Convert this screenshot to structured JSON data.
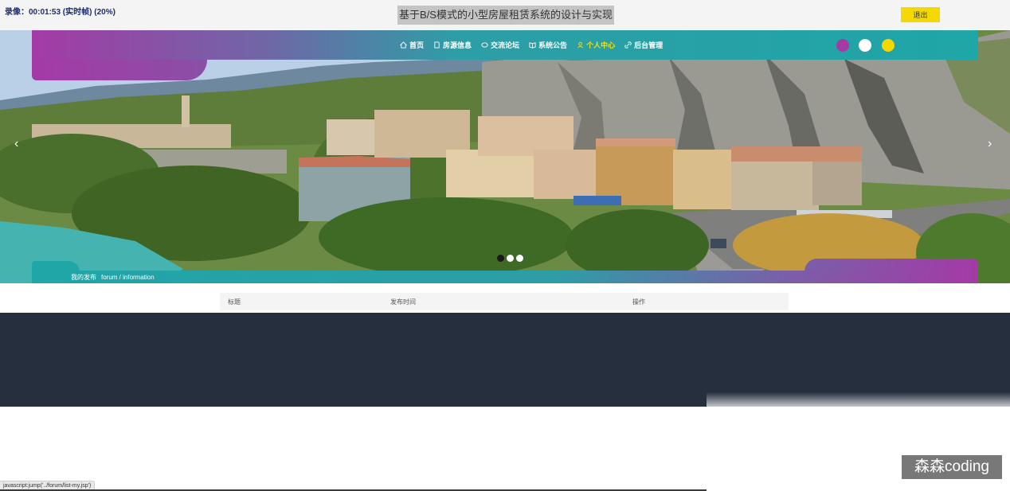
{
  "recording": {
    "label": "录像：00:01:53 (实时帧) (20%)"
  },
  "header": {
    "title": "基于B/S模式的小型房屋租赁系统的设计与实现",
    "logout_label": "退出"
  },
  "nav": {
    "items": [
      {
        "label": "首页",
        "icon": "home-icon"
      },
      {
        "label": "房源信息",
        "icon": "document-icon"
      },
      {
        "label": "交流论坛",
        "icon": "chat-icon"
      },
      {
        "label": "系统公告",
        "icon": "book-icon"
      },
      {
        "label": "个人中心",
        "icon": "user-icon",
        "active": true
      },
      {
        "label": "后台管理",
        "icon": "link-icon"
      }
    ],
    "active_color": "#ffe000"
  },
  "themes": {
    "colors": [
      "#a43aa6",
      "#ffffff",
      "#f5d800"
    ]
  },
  "carousel": {
    "slide_count": 3,
    "active_index": 0
  },
  "breadcrumb": {
    "current": "我的发布",
    "path": "forum / information"
  },
  "table": {
    "columns": [
      "标题",
      "发布时间",
      "操作"
    ]
  },
  "watermark": {
    "text": "森森coding"
  },
  "status_bar": {
    "url": "javascript:jump('../forum/list-my.jsp')"
  }
}
